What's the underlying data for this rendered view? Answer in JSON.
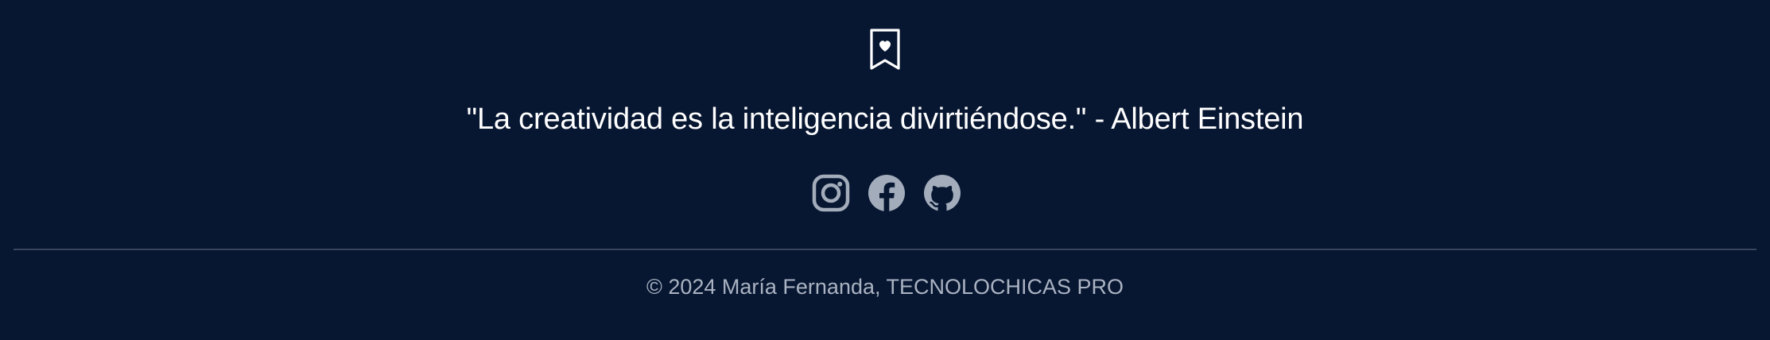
{
  "footer": {
    "logo_icon": "bookmark-heart-icon",
    "quote": "\"La creatividad es la inteligencia divirtiéndose.\" - Albert Einstein",
    "social": [
      {
        "name": "instagram",
        "icon": "instagram-icon"
      },
      {
        "name": "facebook",
        "icon": "facebook-icon"
      },
      {
        "name": "github",
        "icon": "github-icon"
      }
    ],
    "copyright": "© 2024 María Fernanda, TECNOLOCHICAS PRO"
  },
  "colors": {
    "background": "#071631",
    "quote_text": "#ffffff",
    "icons": "#a2acbb",
    "copyright_text": "#aab3c2",
    "divider": "#3a465c"
  }
}
